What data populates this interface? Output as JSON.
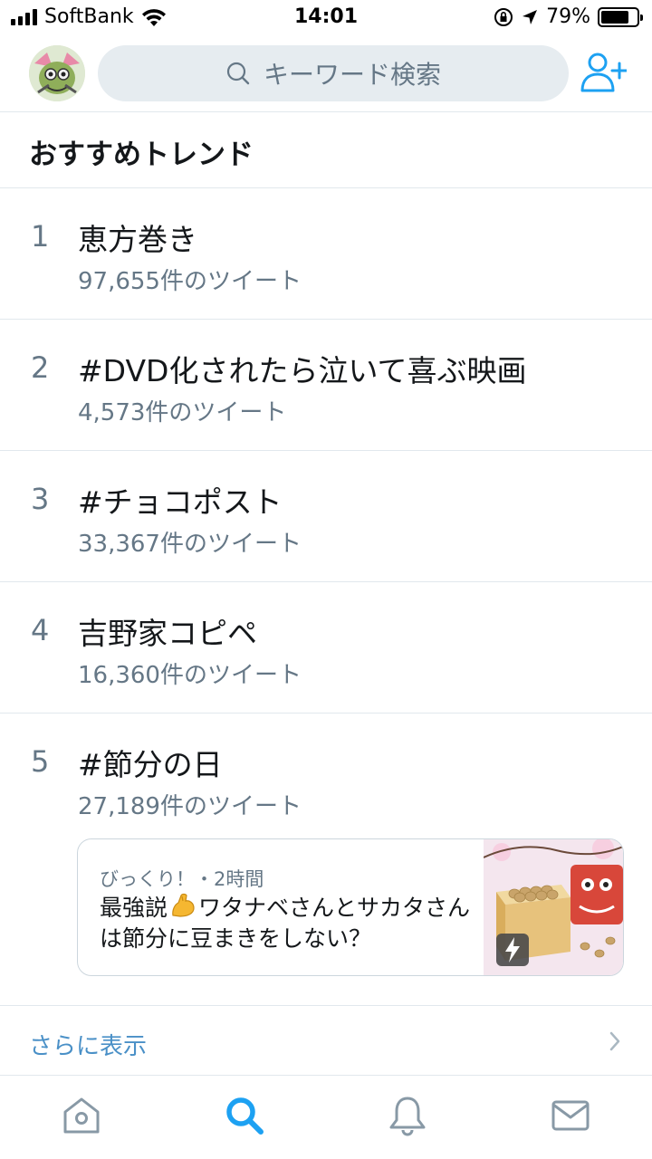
{
  "status_bar": {
    "carrier": "SoftBank",
    "time": "14:01",
    "battery_percent": "79%",
    "battery_level": 0.79
  },
  "search": {
    "placeholder": "キーワード検索"
  },
  "section": {
    "title": "おすすめトレンド"
  },
  "trends": [
    {
      "rank": "1",
      "name": "恵方巻き",
      "count": "97,655件のツイート"
    },
    {
      "rank": "2",
      "name": "#DVD化されたら泣いて喜ぶ映画",
      "count": "4,573件のツイート"
    },
    {
      "rank": "3",
      "name": "#チョコポスト",
      "count": "33,367件のツイート"
    },
    {
      "rank": "4",
      "name": "吉野家コピペ",
      "count": "16,360件のツイート"
    },
    {
      "rank": "5",
      "name": "#節分の日",
      "count": "27,189件のツイート"
    }
  ],
  "news_card": {
    "meta": "びっくり！・2時間",
    "headline_part1": "最強説",
    "headline_part2": "ワタナベさんとサカタさんは節分に豆まきをしない？",
    "emoji_icon": "flexed-biceps-icon",
    "badge_icon": "lightning-icon"
  },
  "show_more": {
    "label": "さらに表示"
  },
  "tabs": [
    {
      "name": "home",
      "icon": "home-icon",
      "active": false
    },
    {
      "name": "search",
      "icon": "search-icon",
      "active": true
    },
    {
      "name": "notifications",
      "icon": "bell-icon",
      "active": false
    },
    {
      "name": "messages",
      "icon": "mail-icon",
      "active": false
    }
  ],
  "colors": {
    "accent": "#1da1f2",
    "link": "#4a90c7",
    "secondary_text": "#657786",
    "divider": "#e1e8ed",
    "search_bg": "#e6ecf0"
  }
}
